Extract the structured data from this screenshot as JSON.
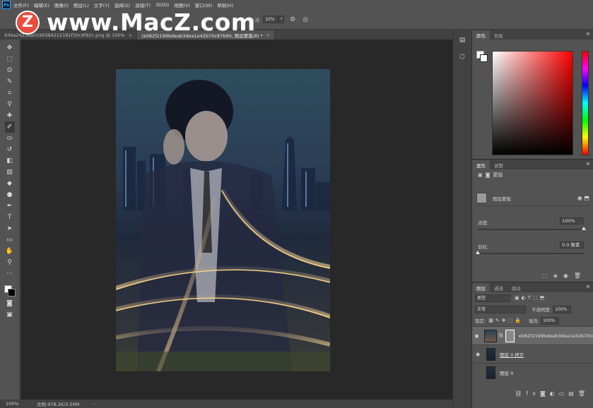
{
  "menu": {
    "logo": "Ps",
    "items": [
      "文件(F)",
      "编辑(E)",
      "图像(I)",
      "图层(L)",
      "文字(Y)",
      "选择(S)",
      "滤镜(T)",
      "3D(D)",
      "视图(V)",
      "窗口(W)",
      "帮助(H)"
    ]
  },
  "watermark": {
    "badge": "Z",
    "text": "www.MacZ.com"
  },
  "options": {
    "smoothing_label": "平滑:",
    "smoothing_value": "10%"
  },
  "tabs": [
    {
      "label": "934a2423aa0190384212181f30c4f92c.png @ 100%",
      "active": false,
      "close": "×"
    },
    {
      "label": "(e082f2199bdeab3dea1e42b70c87b90, 图层蒙版/8) *",
      "active": true,
      "close": "×"
    }
  ],
  "status": {
    "zoom": "100%",
    "doc_size": "文档:978.2K/3.50M",
    "arrow": "›"
  },
  "color_panel": {
    "tabs": [
      "颜色",
      "色板"
    ]
  },
  "properties_panel": {
    "tabs": [
      "属性",
      "调整"
    ],
    "mask_type": "蒙版",
    "mask_label": "图层蒙版",
    "density_label": "浓度:",
    "density_value": "100%",
    "density_fraction": 1.0,
    "feather_label": "羽化:",
    "feather_value": "0.0 像素",
    "feather_fraction": 0.0
  },
  "layers_panel": {
    "tabs": [
      "图层",
      "通道",
      "路径"
    ],
    "filter_kind": "类型",
    "blend_mode": "正常",
    "opacity_label": "不透明度:",
    "opacity_value": "100%",
    "lock_label": "锁定:",
    "fill_label": "填充:",
    "fill_value": "100%",
    "layers": [
      {
        "name": "e082f2199bdeab3dea1e42b70c87b90...",
        "selected": true,
        "visible": true
      },
      {
        "name": "图层 0 拷贝",
        "selected": false,
        "visible": true
      },
      {
        "name": "图层 0",
        "selected": false,
        "visible": false
      }
    ]
  }
}
